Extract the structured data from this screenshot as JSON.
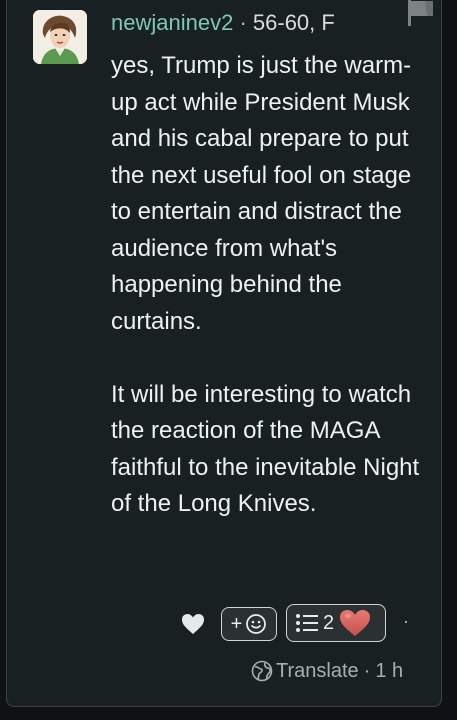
{
  "post": {
    "username": "newjaninev2",
    "separator": "·",
    "age_gender": "56-60, F",
    "paragraphs": [
      "yes, Trump is just the warm-up act while President Musk and his cabal prepare to put the next useful fool on stage to entertain and distract the audience from what's happening behind the curtains.",
      "It will be interesting to watch the reaction of the MAGA faithful to the inevitable Night of the Long Knives."
    ]
  },
  "actions": {
    "like_icon": "heart-icon",
    "add_reaction_label": "+",
    "add_reaction_icon": "smiley-icon",
    "reaction_list_icon": "list-icon",
    "reaction_count": "2",
    "reaction_icon": "heart-icon",
    "menu_label": "·"
  },
  "footer": {
    "translate_label": "Translate",
    "separator": "·",
    "time": "1 h"
  },
  "colors": {
    "background": "#0f1112",
    "card": "#182022",
    "username": "#7fc7b6",
    "text": "#eef1f1",
    "heart": "#d9605c"
  }
}
